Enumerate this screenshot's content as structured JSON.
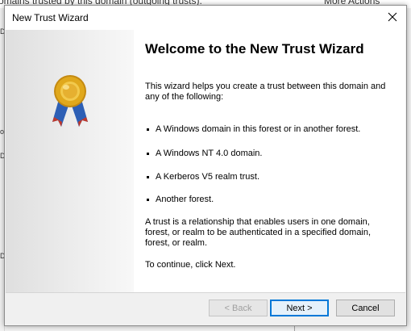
{
  "background": {
    "top_left_text": "omains trusted by this domain (outgoing trusts):",
    "top_right_text": "More Actions",
    "left_marks": [
      "D",
      "o",
      "D",
      "D"
    ]
  },
  "dialog": {
    "title": "New Trust Wizard",
    "close_label": "✕"
  },
  "welcome": {
    "heading": "Welcome to the New Trust Wizard",
    "intro": "This wizard helps you create a trust between this domain and any of the following:",
    "bullets": [
      "A Windows domain in this forest or in another forest.",
      "A Windows NT 4.0 domain.",
      "A Kerberos V5 realm trust.",
      "Another forest."
    ],
    "footer": "A trust is a relationship that enables users in one domain, forest, or realm to be authenticated in a specified domain, forest, or realm.",
    "continue": "To continue, click Next."
  },
  "buttons": {
    "back": "< Back",
    "next": "Next >",
    "cancel": "Cancel"
  },
  "icons": {
    "side": "award-ribbon-icon",
    "close": "close-icon"
  },
  "colors": {
    "accent": "#0078d7",
    "medal_gold": "#e0a81c",
    "ribbon_blue": "#2d5fb5",
    "ribbon_red": "#c0392b"
  }
}
